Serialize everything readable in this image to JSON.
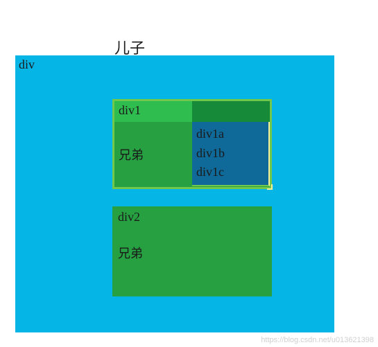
{
  "top_label": "儿子",
  "outer": {
    "label": "div"
  },
  "inner1": {
    "name": "div1",
    "sibling_label": "兄弟",
    "children": {
      "a": "div1a",
      "b": "div1b",
      "c": "div1c"
    }
  },
  "inner2": {
    "name": "div2",
    "sibling_label": "兄弟"
  },
  "watermark": "https://blog.csdn.net/u013621398"
}
